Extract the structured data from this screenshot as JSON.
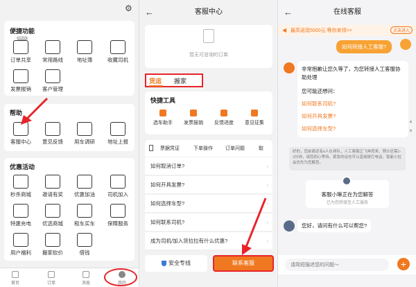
{
  "panel1": {
    "sections": [
      {
        "title": "便捷功能",
        "items": [
          {
            "label": "订单共享",
            "icon": "share-order-icon",
            "badge": "NEW"
          },
          {
            "label": "常用路线",
            "icon": "route-icon"
          },
          {
            "label": "地址簿",
            "icon": "address-book-icon"
          },
          {
            "label": "收藏司机",
            "icon": "favorite-driver-icon"
          },
          {
            "label": "发票报销",
            "icon": "invoice-icon"
          },
          {
            "label": "客户管理",
            "icon": "customer-icon"
          }
        ]
      },
      {
        "title": "帮助",
        "items": [
          {
            "label": "客服中心",
            "icon": "customer-service-icon"
          },
          {
            "label": "意见反馈",
            "icon": "feedback-icon"
          },
          {
            "label": "用车调研",
            "icon": "survey-icon"
          },
          {
            "label": "地址上报",
            "icon": "address-report-icon"
          }
        ]
      },
      {
        "title": "优惠活动",
        "items": [
          {
            "label": "秒杀商城",
            "icon": "shop-icon"
          },
          {
            "label": "邀请有奖",
            "icon": "gift-icon"
          },
          {
            "label": "优惠加油",
            "icon": "fuel-icon"
          },
          {
            "label": "司机加入",
            "icon": "driver-join-icon"
          },
          {
            "label": "特惠充电",
            "icon": "charge-icon"
          },
          {
            "label": "优选商城",
            "icon": "mall-icon"
          },
          {
            "label": "租车买车",
            "icon": "car-icon"
          },
          {
            "label": "保障服务",
            "icon": "shield-icon"
          },
          {
            "label": "用户福利",
            "icon": "welfare-icon"
          },
          {
            "label": "搬家砍价",
            "icon": "move-icon"
          },
          {
            "label": "借钱",
            "icon": "money-icon"
          }
        ]
      }
    ],
    "tabs": [
      "首页",
      "订单",
      "消息",
      "我的"
    ]
  },
  "panel2": {
    "title": "客服中心",
    "empty_text": "暂无可咨询的订单",
    "biz_tabs": [
      "货运",
      "搬家"
    ],
    "quick_title": "快捷工具",
    "quick_items": [
      "选车助手",
      "发票报销",
      "反馈进度",
      "意见征集"
    ],
    "q_tabs": [
      "票据凭证",
      "下单操作",
      "订单问题",
      "取"
    ],
    "questions": [
      "如何取消订单?",
      "如何开具发票?",
      "如何选择车型?",
      "如何联系司机?",
      "成为司机/加入货拉拉有什么优惠?"
    ],
    "safety_btn": "安全专线",
    "contact_btn": "联系客服"
  },
  "panel3": {
    "title": "在线客服",
    "promo": "最高返现5000元 等你来领>>",
    "promo_btn": "点击进入",
    "user_msg": "如何转接人工客服?",
    "bot_msg_1": "非常抱歉让您久等了，为您转接人工客服协助处理",
    "bot_msg_2": "您可能还想问：",
    "links": [
      "如何联系司机?",
      "如何开具发票?",
      "如何选择车型?"
    ],
    "queue_notice": "好的，您前面还有a人在排队，人工客服正飞奔而来，预计还需1-3分钟，请您耐心等待。紧急的话也可以直接拨打电话，智能小拉会优先为您解答。",
    "agent_name": "客服小琳正在为您解答",
    "agent_sub": "已为您转接至人工服务",
    "agent_msg": "您好，请问有什么可以帮您?",
    "input_placeholder": "请简短描述您的问题～"
  },
  "colors": {
    "accent": "#f07820",
    "red": "#e8232a"
  }
}
